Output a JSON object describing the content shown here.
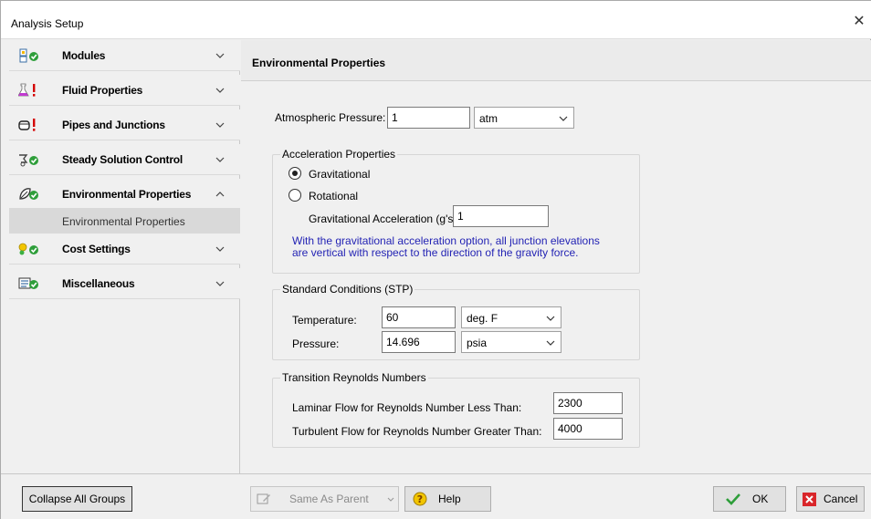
{
  "window": {
    "title": "Analysis Setup",
    "close_symbol": "✕"
  },
  "sidebar": {
    "groups": [
      {
        "label": "Modules",
        "icon": "modules-icon",
        "expanded": false
      },
      {
        "label": "Fluid Properties",
        "icon": "fluid-properties-warning-icon",
        "expanded": false
      },
      {
        "label": "Pipes and Junctions",
        "icon": "pipes-junctions-warning-icon",
        "expanded": false
      },
      {
        "label": "Steady Solution Control",
        "icon": "steady-solution-icon",
        "expanded": false
      },
      {
        "label": "Environmental Properties",
        "icon": "environmental-properties-icon",
        "expanded": true
      },
      {
        "label": "Cost Settings",
        "icon": "cost-settings-icon",
        "expanded": false
      },
      {
        "label": "Miscellaneous",
        "icon": "miscellaneous-icon",
        "expanded": false
      }
    ],
    "sub_items": [
      {
        "label": "Environmental Properties",
        "selected": true
      }
    ]
  },
  "content": {
    "header": "Environmental Properties",
    "atmospheric_pressure": {
      "label": "Atmospheric Pressure:",
      "value": "1",
      "unit": "atm"
    },
    "acceleration": {
      "legend": "Acceleration Properties",
      "gravitational_label": "Gravitational",
      "rotational_label": "Rotational",
      "selected": "Gravitational",
      "grav_accel_label": "Gravitational Acceleration (g's):",
      "grav_accel_value": "1",
      "note_line1": "With the gravitational acceleration option, all junction elevations",
      "note_line2": "are vertical with respect to the direction of the gravity force."
    },
    "stp": {
      "legend": "Standard Conditions (STP)",
      "temperature_label": "Temperature:",
      "temperature_value": "60",
      "temperature_unit": "deg. F",
      "pressure_label": "Pressure:",
      "pressure_value": "14.696",
      "pressure_unit": "psia"
    },
    "reynolds": {
      "legend": "Transition Reynolds Numbers",
      "laminar_label": "Laminar Flow for Reynolds Number Less Than:",
      "laminar_value": "2300",
      "turbulent_label": "Turbulent Flow for Reynolds Number Greater Than:",
      "turbulent_value": "4000"
    }
  },
  "footer": {
    "collapse_all": "Collapse All Groups",
    "same_as_parent": "Same As Parent",
    "help": "Help",
    "ok": "OK",
    "cancel": "Cancel"
  },
  "colors": {
    "note_text": "#2323b4",
    "check_green": "#2e9e3a",
    "warning_red": "#d40000",
    "cancel_red": "#d9262a"
  }
}
